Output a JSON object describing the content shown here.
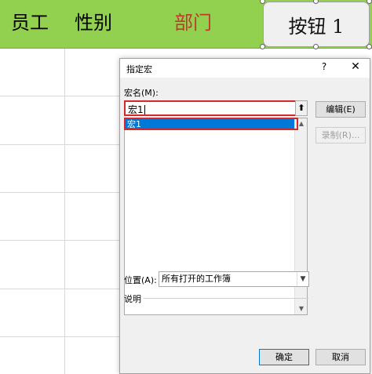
{
  "sheet": {
    "header_cells": [
      "员工",
      "性别",
      "部门"
    ],
    "accent_header_bg": "#92d050",
    "dept_text_color": "#c0392b"
  },
  "sheet_button": {
    "label": "按钮 1"
  },
  "dialog": {
    "title": "指定宏",
    "help": "?",
    "close": "✕",
    "macro_name_label": "宏名(M):",
    "macro_name_value": "宏1",
    "macro_list": [
      "宏1"
    ],
    "edit_button": "编辑(E)",
    "record_button": "录制(R)...",
    "location_label": "位置(A):",
    "location_value": "所有打开的工作簿",
    "description_label": "说明",
    "ok_button": "确定",
    "cancel_button": "取消",
    "upload_icon": "arrow-up-icon",
    "highlight_color": "#d62828",
    "selection_color": "#0078d7"
  }
}
